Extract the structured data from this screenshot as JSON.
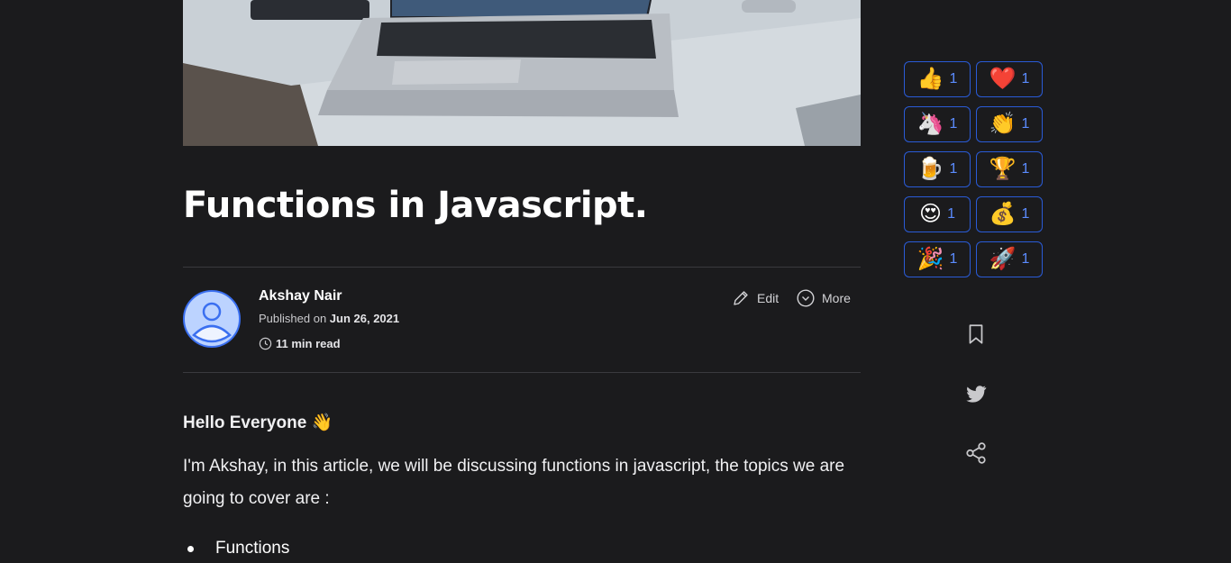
{
  "article": {
    "title": "Functions in Javascript.",
    "author": "Akshay Nair",
    "published_prefix": "Published on",
    "published_date": "Jun 26, 2021",
    "read_time": "11 min read",
    "actions": {
      "edit": "Edit",
      "more": "More"
    },
    "greeting": "Hello Everyone 👋",
    "intro": "I'm Akshay, in this article, we will be discussing functions in javascript, the topics we are going to cover are :",
    "list": [
      "Functions"
    ]
  },
  "reactions": [
    {
      "emoji": "👍",
      "count": "1",
      "name": "thumbs-up"
    },
    {
      "emoji": "❤️",
      "count": "1",
      "name": "heart"
    },
    {
      "emoji": "🦄",
      "count": "1",
      "name": "unicorn"
    },
    {
      "emoji": "👏",
      "count": "1",
      "name": "clap"
    },
    {
      "emoji": "🍺",
      "count": "1",
      "name": "beer"
    },
    {
      "emoji": "🏆",
      "count": "1",
      "name": "trophy"
    },
    {
      "emoji": "😍",
      "count": "1",
      "name": "heart-eyes"
    },
    {
      "emoji": "💰",
      "count": "1",
      "name": "money-bag"
    },
    {
      "emoji": "🎉",
      "count": "1",
      "name": "party"
    },
    {
      "emoji": "🚀",
      "count": "1",
      "name": "rocket"
    }
  ],
  "side_icons": [
    "bookmark-icon",
    "twitter-icon",
    "share-icon"
  ],
  "colors": {
    "background": "#1b1b1d",
    "accent": "#2a5bd7",
    "count": "#5b8cff"
  }
}
